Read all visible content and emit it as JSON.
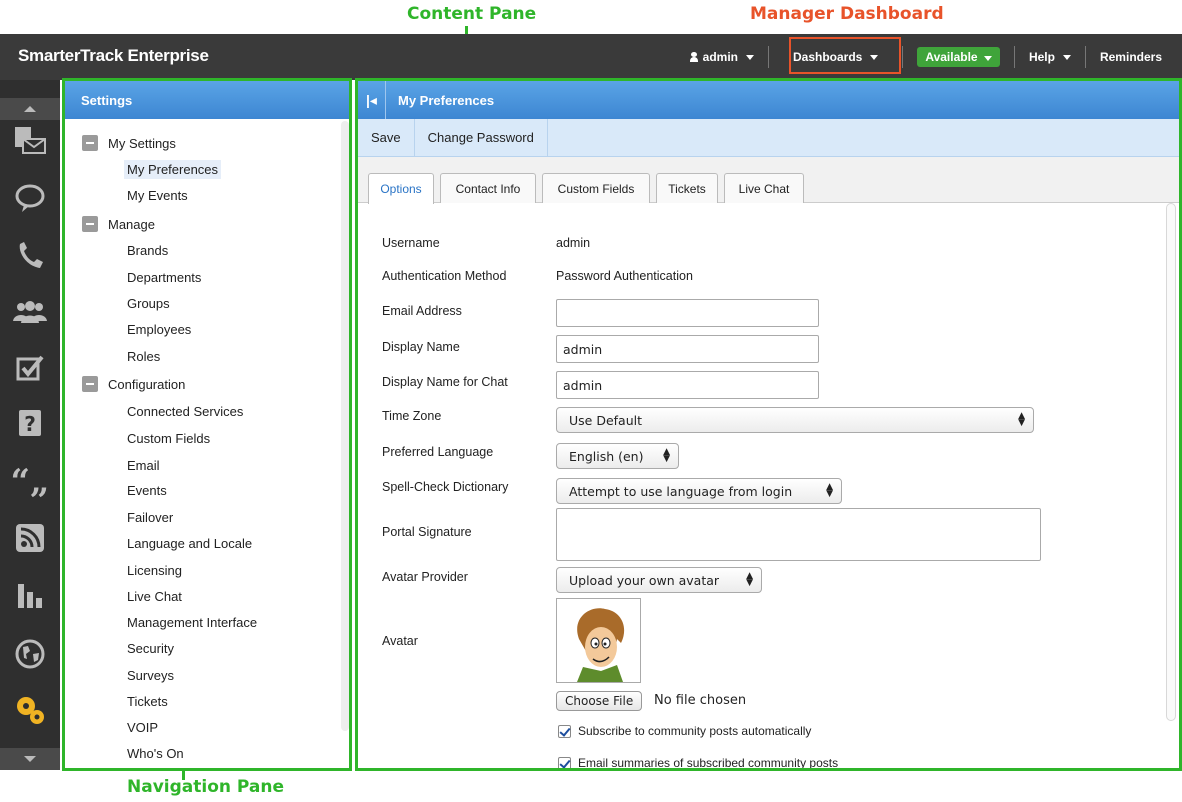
{
  "annotations": {
    "content_pane": "Content Pane",
    "manager_dashboard": "Manager Dashboard",
    "navigation_pane": "Navigation Pane"
  },
  "topbar": {
    "brand": "SmarterTrack Enterprise",
    "user": "admin",
    "dashboards": "Dashboards",
    "status": "Available",
    "help": "Help",
    "reminders": "Reminders"
  },
  "rail": {
    "icons": [
      "tickets-icon",
      "chat-bubble-icon",
      "phone-icon",
      "people-icon",
      "checkbox-icon",
      "question-icon",
      "quote-icon",
      "rss-icon",
      "bar-chart-icon",
      "globe-icon",
      "gears-icon"
    ]
  },
  "nav": {
    "title": "Settings",
    "groups": [
      {
        "label": "My Settings",
        "items": [
          "My Preferences",
          "My Events"
        ]
      },
      {
        "label": "Manage",
        "items": [
          "Brands",
          "Departments",
          "Groups",
          "Employees",
          "Roles"
        ]
      },
      {
        "label": "Configuration",
        "items": [
          "Connected Services",
          "Custom Fields",
          "Email",
          "Events",
          "Failover",
          "Language and Locale",
          "Licensing",
          "Live Chat",
          "Management Interface",
          "Security",
          "Surveys",
          "Tickets",
          "VOIP",
          "Who's On"
        ]
      }
    ],
    "selected": "My Preferences"
  },
  "content": {
    "title": "My Preferences",
    "toolbar": {
      "save": "Save",
      "change_password": "Change Password"
    },
    "tabs": [
      "Options",
      "Contact Info",
      "Custom Fields",
      "Tickets",
      "Live Chat"
    ],
    "active_tab": "Options",
    "form": {
      "username_label": "Username",
      "username_value": "admin",
      "auth_label": "Authentication Method",
      "auth_value": "Password Authentication",
      "email_label": "Email Address",
      "email_value": "",
      "display_name_label": "Display Name",
      "display_name_value": "admin",
      "display_name_chat_label": "Display Name for Chat",
      "display_name_chat_value": "admin",
      "time_zone_label": "Time Zone",
      "time_zone_value": "Use Default",
      "language_label": "Preferred Language",
      "language_value": "English (en)",
      "spell_label": "Spell-Check Dictionary",
      "spell_value": "Attempt to use language from login",
      "signature_label": "Portal Signature",
      "signature_value": "",
      "avatar_provider_label": "Avatar Provider",
      "avatar_provider_value": "Upload your own avatar",
      "avatar_label": "Avatar",
      "choose_file": "Choose File",
      "no_file": "No file chosen",
      "subscribe_label": "Subscribe to community posts automatically",
      "subscribe_checked": true,
      "email_summaries_label": "Email summaries of subscribed community posts",
      "email_summaries_checked": true
    }
  },
  "colors": {
    "annotation_green": "#2fb52a",
    "annotation_red": "#e8532a",
    "header_blue": "#3d86d2",
    "available_green": "#3fa43a"
  }
}
